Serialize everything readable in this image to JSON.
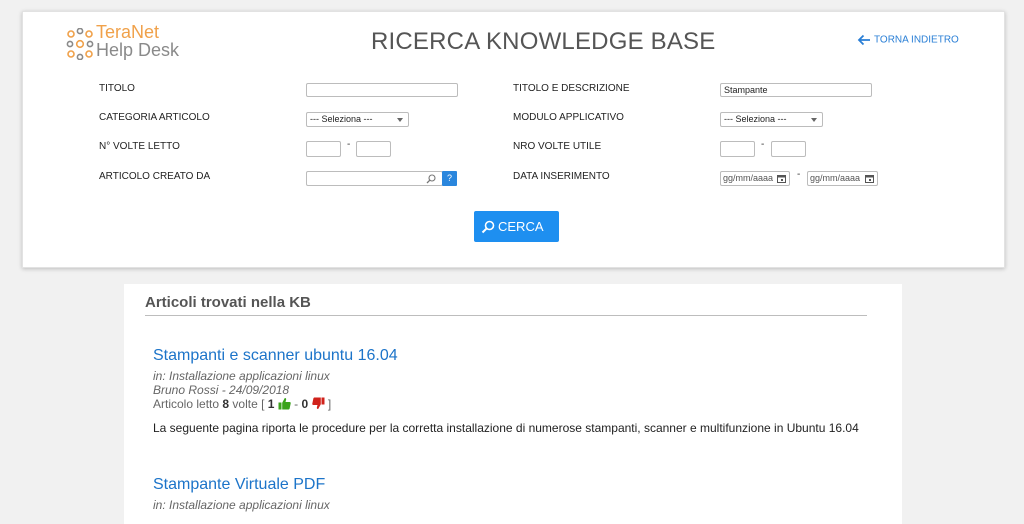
{
  "header": {
    "logo_line1": "TeraNet",
    "logo_line2": "Help Desk",
    "title": "RICERCA KNOWLEDGE BASE",
    "back_label": "TORNA INDIETRO"
  },
  "form": {
    "titolo_label": "TITOLO",
    "titolo_value": "",
    "titolo_desc_label": "TITOLO E DESCRIZIONE",
    "titolo_desc_value": "Stampante",
    "categoria_label": "CATEGORIA ARTICOLO",
    "categoria_value": "--- Seleziona ---",
    "modulo_label": "MODULO APPLICATIVO",
    "modulo_value": "--- Seleziona ---",
    "volte_letto_label": "N° VOLTE LETTO",
    "volte_utile_label": "NRO VOLTE UTILE",
    "range_separator": "-",
    "creato_da_label": "ARTICOLO CREATO DA",
    "help_symbol": "?",
    "data_label": "DATA INSERIMENTO",
    "date_placeholder": "gg/mm/aaaa",
    "search_label": "CERCA"
  },
  "results": {
    "heading": "Articoli trovati nella KB",
    "articles": [
      {
        "title": "Stampanti e scanner ubuntu 16.04",
        "category": "in: Installazione applicazioni linux",
        "author_date": "Bruno Rossi - 24/09/2018",
        "read_prefix": "Articolo letto",
        "read_count": "8",
        "read_suffix": "volte [",
        "likes": "1",
        "sep": "-",
        "dislikes": "0",
        "close": "]",
        "description": "La seguente pagina riporta le procedure per la corretta installazione di numerose stampanti, scanner e multifunzione in Ubuntu 16.04"
      },
      {
        "title": "Stampante Virtuale PDF",
        "category": "in: Installazione applicazioni linux"
      }
    ]
  },
  "colors": {
    "accent": "#1e8ff0",
    "link": "#1c74c9",
    "logo_orange": "#f0a14a",
    "like_green": "#3aa31a",
    "dislike_red": "#d0221b"
  }
}
